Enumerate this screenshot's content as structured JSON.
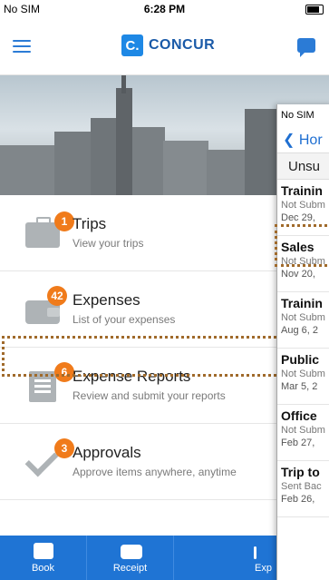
{
  "status_bar": {
    "carrier": "No SIM",
    "time": "6:28 PM"
  },
  "header": {
    "logo_mark": "C.",
    "logo_text": "CONCUR"
  },
  "menu": [
    {
      "title": "Trips",
      "subtitle": "View your trips",
      "badge": "1",
      "icon": "suitcase-icon"
    },
    {
      "title": "Expenses",
      "subtitle": "List of your expenses",
      "badge": "42",
      "icon": "wallet-icon"
    },
    {
      "title": "Expense Reports",
      "subtitle": "Review and submit your reports",
      "badge": "6",
      "icon": "report-icon"
    },
    {
      "title": "Approvals",
      "subtitle": "Approve items anywhere, anytime",
      "badge": "3",
      "icon": "checkmark-icon"
    }
  ],
  "tabbar": [
    {
      "label": "Book",
      "icon": "book-icon"
    },
    {
      "label": "Receipt",
      "icon": "camera-icon"
    },
    {
      "label": "Exp",
      "icon": "expense-icon"
    }
  ],
  "overlay": {
    "status_carrier": "No SIM",
    "back_label": "Hor",
    "section": "Unsu",
    "rows": [
      {
        "title": "Trainin",
        "status": "Not Subm",
        "date": "Dec 29,"
      },
      {
        "title": "Sales",
        "status": "Not Subm",
        "date": "Nov 20,"
      },
      {
        "title": "Trainin",
        "status": "Not Subm",
        "date": "Aug 6, 2"
      },
      {
        "title": "Public",
        "status": "Not Subm",
        "date": "Mar 5, 2"
      },
      {
        "title": "Office",
        "status": "Not Subm",
        "date": "Feb 27,"
      },
      {
        "title": "Trip to",
        "status": "Sent Bac",
        "date": "Feb 26,"
      }
    ]
  },
  "colors": {
    "accent": "#1f74d4",
    "badge": "#f07b1b",
    "highlight": "#a06a2b"
  }
}
